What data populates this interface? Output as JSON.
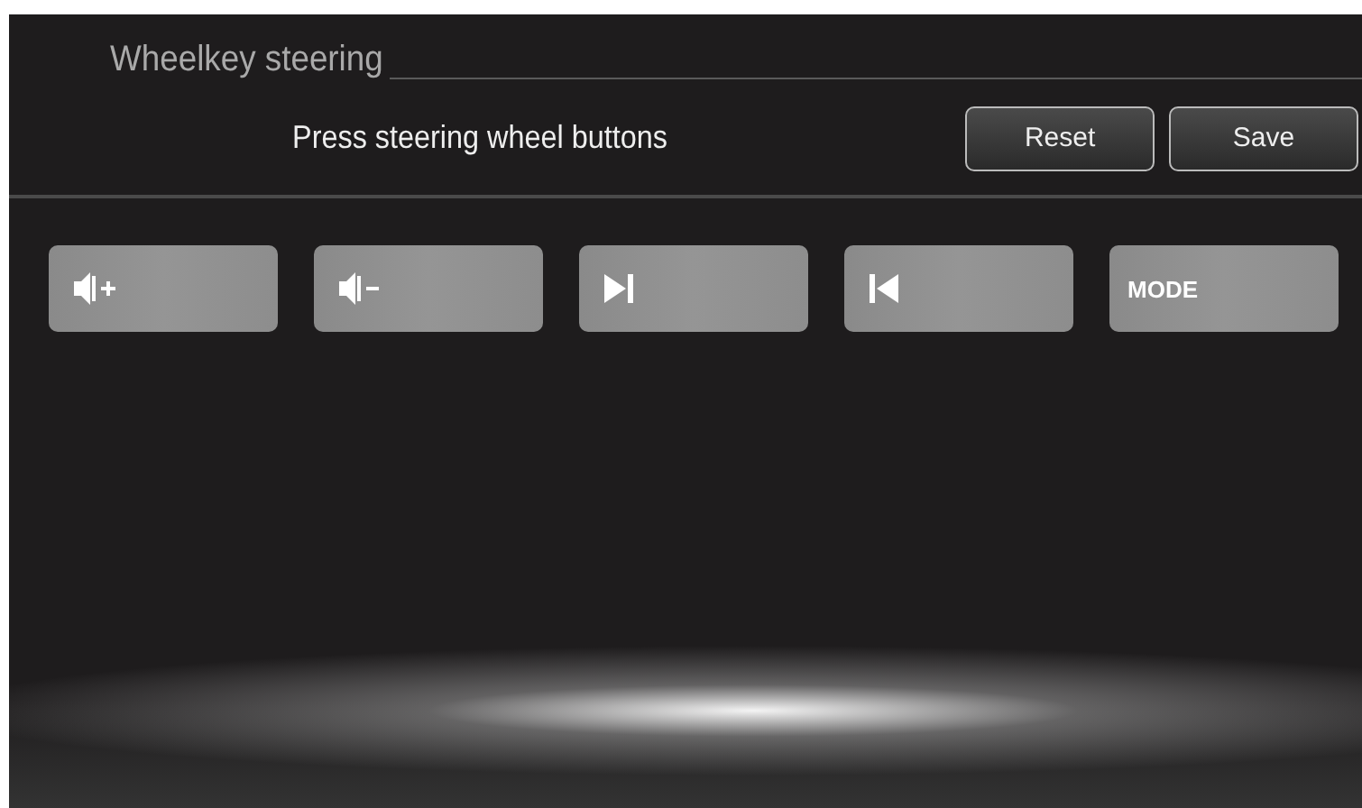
{
  "screen": {
    "title": "Wheelkey steering",
    "instruction": "Press steering wheel buttons",
    "buttons": [
      "Reset",
      "Save"
    ]
  },
  "keys": [
    {
      "kind": "volume_up"
    },
    {
      "kind": "volume_down"
    },
    {
      "kind": "next"
    },
    {
      "kind": "previous"
    },
    {
      "kind": "text",
      "label": "MODE"
    }
  ]
}
